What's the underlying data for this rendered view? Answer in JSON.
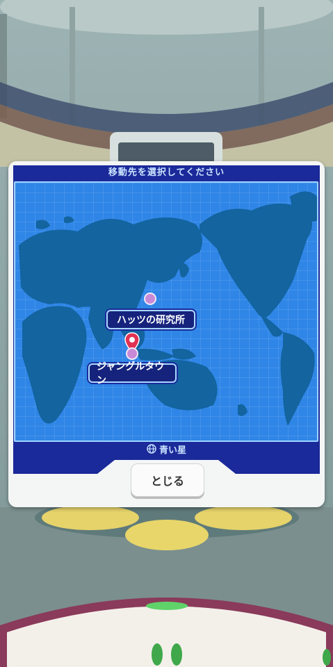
{
  "dialog": {
    "title": "移動先を選択してください",
    "planet_label": "青い星",
    "close_label": "とじる"
  },
  "locations": [
    {
      "name": "ハッツの研究所",
      "selected": false
    },
    {
      "name": "ジャングルタウン",
      "selected": true
    }
  ],
  "colors": {
    "panel": "#1a2a9a",
    "map_ocean": "#2f86e7",
    "land": "#13649f",
    "marker_dot": "#c88ad6",
    "pin": "#e23253"
  },
  "icons": {
    "globe": "globe-icon",
    "pin": "location-pin-icon"
  }
}
